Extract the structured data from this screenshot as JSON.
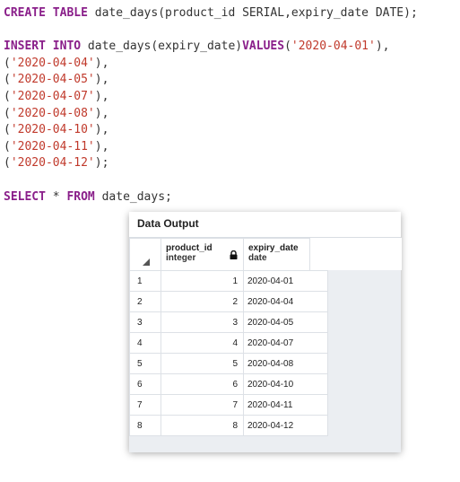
{
  "editor": {
    "lines": [
      {
        "segments": [
          {
            "t": "CREATE TABLE",
            "k": "kw"
          },
          {
            "t": " date_days(product_id SERIAL,expiry_date DATE);",
            "k": "op"
          }
        ]
      },
      {
        "segments": []
      },
      {
        "segments": [
          {
            "t": "INSERT INTO",
            "k": "kw"
          },
          {
            "t": " date_days(expiry_date)",
            "k": "op"
          },
          {
            "t": "VALUES",
            "k": "kw"
          },
          {
            "t": "(",
            "k": "op"
          },
          {
            "t": "'2020-04-01'",
            "k": "str"
          },
          {
            "t": "),",
            "k": "op"
          }
        ]
      },
      {
        "segments": [
          {
            "t": "(",
            "k": "op"
          },
          {
            "t": "'2020-04-04'",
            "k": "str"
          },
          {
            "t": "),",
            "k": "op"
          }
        ]
      },
      {
        "segments": [
          {
            "t": "(",
            "k": "op"
          },
          {
            "t": "'2020-04-05'",
            "k": "str"
          },
          {
            "t": "),",
            "k": "op"
          }
        ]
      },
      {
        "segments": [
          {
            "t": "(",
            "k": "op"
          },
          {
            "t": "'2020-04-07'",
            "k": "str"
          },
          {
            "t": "),",
            "k": "op"
          }
        ]
      },
      {
        "segments": [
          {
            "t": "(",
            "k": "op"
          },
          {
            "t": "'2020-04-08'",
            "k": "str"
          },
          {
            "t": "),",
            "k": "op"
          }
        ]
      },
      {
        "segments": [
          {
            "t": "(",
            "k": "op"
          },
          {
            "t": "'2020-04-10'",
            "k": "str"
          },
          {
            "t": "),",
            "k": "op"
          }
        ]
      },
      {
        "segments": [
          {
            "t": "(",
            "k": "op"
          },
          {
            "t": "'2020-04-11'",
            "k": "str"
          },
          {
            "t": "),",
            "k": "op"
          }
        ]
      },
      {
        "segments": [
          {
            "t": "(",
            "k": "op"
          },
          {
            "t": "'2020-04-12'",
            "k": "str"
          },
          {
            "t": ");",
            "k": "op"
          }
        ]
      },
      {
        "segments": []
      },
      {
        "segments": [
          {
            "t": "SELECT",
            "k": "kw"
          },
          {
            "t": " * ",
            "k": "op"
          },
          {
            "t": "FROM",
            "k": "kw"
          },
          {
            "t": " date_days;",
            "k": "op"
          }
        ]
      }
    ]
  },
  "output": {
    "title": "Data Output",
    "columns": [
      {
        "name": "product_id",
        "type": "integer"
      },
      {
        "name": "expiry_date",
        "type": "date"
      }
    ],
    "rows": [
      {
        "n": "1",
        "id": "1",
        "date": "2020-04-01"
      },
      {
        "n": "2",
        "id": "2",
        "date": "2020-04-04"
      },
      {
        "n": "3",
        "id": "3",
        "date": "2020-04-05"
      },
      {
        "n": "4",
        "id": "4",
        "date": "2020-04-07"
      },
      {
        "n": "5",
        "id": "5",
        "date": "2020-04-08"
      },
      {
        "n": "6",
        "id": "6",
        "date": "2020-04-10"
      },
      {
        "n": "7",
        "id": "7",
        "date": "2020-04-11"
      },
      {
        "n": "8",
        "id": "8",
        "date": "2020-04-12"
      }
    ]
  },
  "colors": {
    "keyword": "#8a1f8a",
    "string": "#c0392b",
    "grid_background": "#ebeef2"
  },
  "icons": [
    "lock-icon",
    "sort-triangle-icon"
  ]
}
